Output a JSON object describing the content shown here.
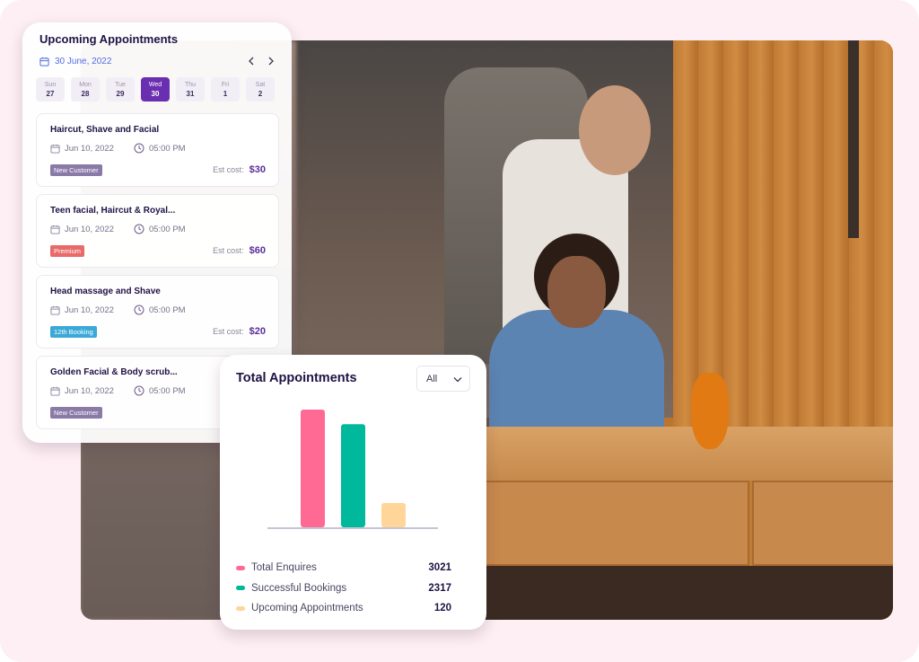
{
  "appointments_panel": {
    "title": "Upcoming Appointments",
    "date": "30 June, 2022",
    "nav": {
      "prev_icon": "chevron-left-icon",
      "next_icon": "chevron-right-icon"
    },
    "days": [
      {
        "name": "Sun",
        "date": "27",
        "selected": false
      },
      {
        "name": "Mon",
        "date": "28",
        "selected": false
      },
      {
        "name": "Tue",
        "date": "29",
        "selected": false
      },
      {
        "name": "Wed",
        "date": "30",
        "selected": true
      },
      {
        "name": "Thu",
        "date": "31",
        "selected": false
      },
      {
        "name": "Fri",
        "date": "1",
        "selected": false
      },
      {
        "name": "Sat",
        "date": "2",
        "selected": false
      }
    ],
    "est_cost_label": "Est cost:",
    "items": [
      {
        "name": "Haircut, Shave and Facial",
        "date": "Jun 10, 2022",
        "time": "05:00 PM",
        "tag": "New Customer",
        "tag_color": "#8a7aa8",
        "cost": "$30"
      },
      {
        "name": "Teen facial, Haircut & Royal...",
        "date": "Jun 10, 2022",
        "time": "05:00 PM",
        "tag": "Premium",
        "tag_color": "#e86a6a",
        "cost": "$60"
      },
      {
        "name": "Head massage and Shave",
        "date": "Jun 10, 2022",
        "time": "05:00 PM",
        "tag": "12th Booking",
        "tag_color": "#3aa9d8",
        "cost": "$20"
      },
      {
        "name": "Golden Facial & Body scrub...",
        "date": "Jun 10, 2022",
        "time": "05:00 PM",
        "tag": "New Customer",
        "tag_color": "#8a7aa8",
        "cost": ""
      }
    ]
  },
  "total_panel": {
    "title": "Total Appointments",
    "filter": {
      "selected": "All"
    }
  },
  "colors": {
    "accent": "#6a2fb0",
    "date_link": "#4f6ee0",
    "background": "#fdeff3"
  },
  "chart_data": {
    "type": "bar",
    "title": "Total Appointments",
    "categories": [
      "Total Enquires",
      "Successful Bookings",
      "Upcoming Appointments"
    ],
    "values": [
      3021,
      2317,
      120
    ],
    "colors": [
      "#ff6a94",
      "#00b89c",
      "#ffd59a"
    ],
    "xlabel": "",
    "ylabel": "",
    "grid": false,
    "legend": "bottom"
  }
}
